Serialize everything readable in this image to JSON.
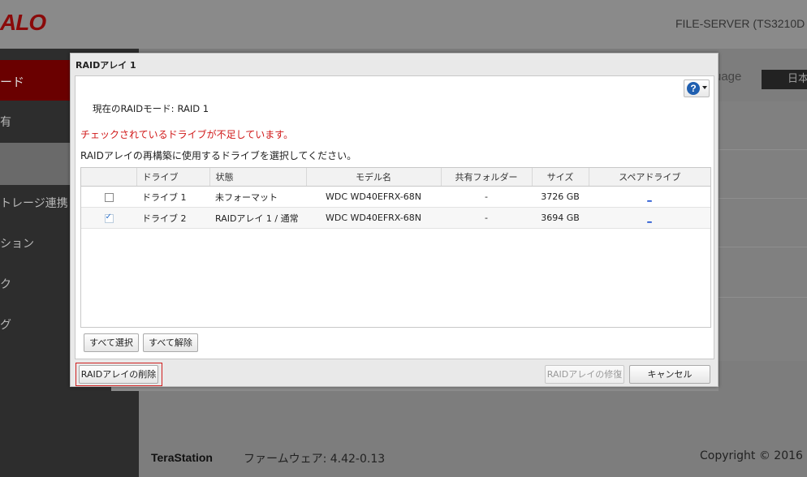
{
  "background": {
    "logo": "ALO",
    "server_name": "FILE-SERVER (TS3210D",
    "sidebar": [
      {
        "label": "ード",
        "active": true
      },
      {
        "label": "有"
      },
      {
        "label": "トレージ連携"
      },
      {
        "label": "ション"
      },
      {
        "label": "ク"
      },
      {
        "label": "グ"
      }
    ],
    "language_label": "uage",
    "language_value": "日本",
    "footer_brand": "TeraStation",
    "footer_firmware": "ファームウェア: 4.42-0.13",
    "copyright": "Copyright © 2016 I"
  },
  "dialog": {
    "title": "RAIDアレイ 1",
    "help_icon": "?",
    "current_mode_label": "現在のRAIDモード:",
    "current_mode_value": "RAID 1",
    "warning": "チェックされているドライブが不足しています。",
    "instruction": "RAIDアレイの再構築に使用するドライブを選択してください。",
    "table": {
      "headers": [
        "",
        "ドライブ",
        "状態",
        "モデル名",
        "共有フォルダー",
        "サイズ",
        "スペアドライブ"
      ],
      "rows": [
        {
          "checked": false,
          "drive": "ドライブ 1",
          "status": "未フォーマット",
          "model": "WDC WD40EFRX-68N",
          "share": "-",
          "size": "3726 GB",
          "spare": "_"
        },
        {
          "checked": true,
          "drive": "ドライブ 2",
          "status": "RAIDアレイ 1 / 通常",
          "model": "WDC WD40EFRX-68N",
          "share": "-",
          "size": "3694 GB",
          "spare": "_"
        }
      ]
    },
    "select_all": "すべて選択",
    "deselect_all": "すべて解除",
    "delete_raid": "RAIDアレイの削除",
    "repair_raid": "RAIDアレイの修復",
    "cancel": "キャンセル"
  }
}
